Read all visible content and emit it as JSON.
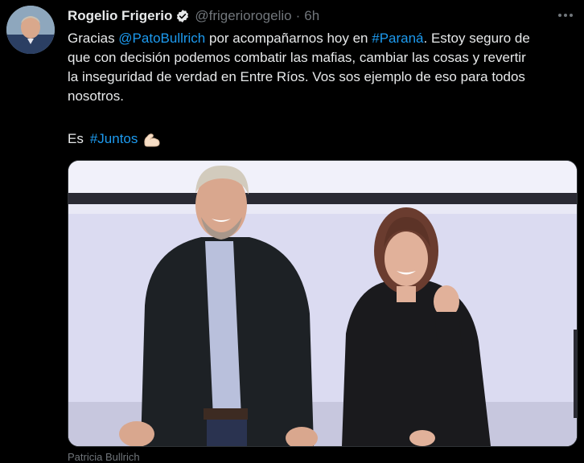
{
  "tweet": {
    "author_name": "Rogelio Frigerio",
    "handle": "@frigeriorogelio",
    "separator": "·",
    "time": "6h",
    "lines": [
      {
        "pre": "Gracias ",
        "link1": "@PatoBullrich",
        "mid": " por acompañarnos hoy en ",
        "link2": "#Paraná",
        "post": ". Estoy seguro de"
      },
      {
        "text": "que con decisión podemos combatir las mafias, cambiar las cosas y revertir"
      },
      {
        "text": "la inseguridad de verdad en Entre Ríos. Vos sos ejemplo de eso para todos"
      },
      {
        "text": "nosotros."
      }
    ],
    "es_prefix": "Es",
    "hashtag": "#Juntos",
    "photo_caption": "Patricia Bullrich"
  },
  "icons": {
    "verified": "verified-badge-icon",
    "more": "more-options-icon",
    "emoji": "flexed-biceps-emoji"
  },
  "colors": {
    "background": "#000000",
    "text": "#e7e9ea",
    "muted": "#71767b",
    "link": "#1d9bf0"
  }
}
